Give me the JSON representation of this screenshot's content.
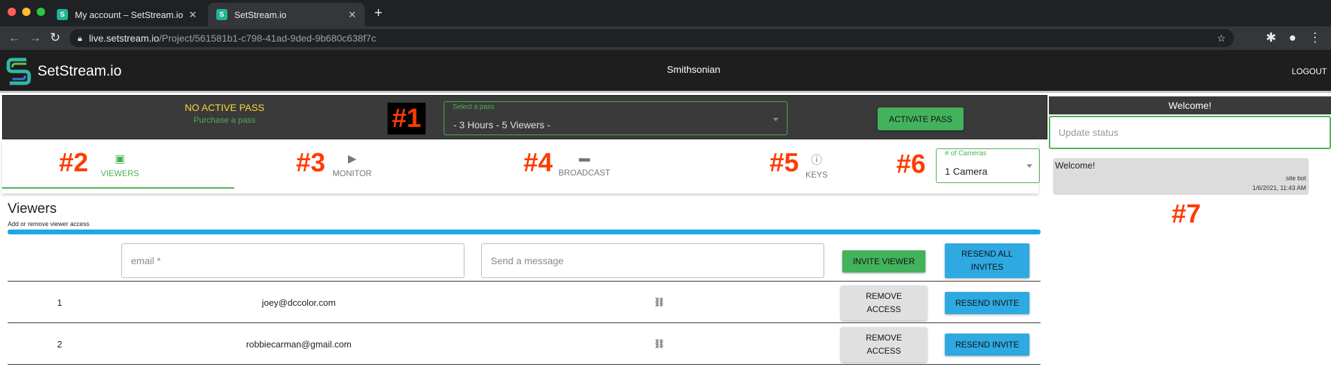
{
  "browser": {
    "tabs": [
      {
        "title": "My account – SetStream.io"
      },
      {
        "title": "SetStream.io"
      }
    ],
    "url_host": "live.setstream.io",
    "url_path": "/Project/561581b1-c798-41ad-9ded-9b680c638f7c"
  },
  "header": {
    "app_name": "SetStream.io",
    "organization": "Smithsonian",
    "logout": "LOGOUT"
  },
  "pass_bar": {
    "status": "NO ACTIVE PASS",
    "purchase_link": "Purchase a pass",
    "select_label": "Select a pass",
    "select_value": "- 3 Hours - 5 Viewers -",
    "activate_button": "ACTIVATE PASS"
  },
  "annotations": [
    "#1",
    "#2",
    "#3",
    "#4",
    "#5",
    "#6",
    "#7"
  ],
  "nav_tabs": [
    {
      "label": "VIEWERS",
      "icon": "contact-card-icon",
      "selected": true
    },
    {
      "label": "MONITOR",
      "icon": "tv-play-icon",
      "selected": false
    },
    {
      "label": "BROADCAST",
      "icon": "clapperboard-icon",
      "selected": false
    },
    {
      "label": "KEYS",
      "icon": "info-circle-icon",
      "selected": false
    }
  ],
  "cameras": {
    "label": "# of Cameras",
    "value": "1 Camera"
  },
  "sidebar": {
    "header": "Welcome!",
    "status_placeholder": "Update status",
    "messages": [
      {
        "text": "Welcome!",
        "author": "site bot",
        "time": "1/6/2021, 11:43 AM"
      }
    ]
  },
  "viewers": {
    "title": "Viewers",
    "subtitle": "Add or remove viewer access",
    "email_placeholder": "email *",
    "message_placeholder": "Send a message",
    "invite_button": "INVITE VIEWER",
    "resend_all_button": "RESEND ALL INVITES",
    "rows": [
      {
        "index": "1",
        "email": "joey@dccolor.com",
        "remove": "REMOVE ACCESS",
        "resend": "RESEND INVITE"
      },
      {
        "index": "2",
        "email": "robbiecarman@gmail.com",
        "remove": "REMOVE ACCESS",
        "resend": "RESEND INVITE"
      }
    ]
  },
  "colors": {
    "accent_green": "#4caf50",
    "accent_blue": "#1ea7e4",
    "annotation_red": "#ff3b00",
    "header_dark": "#1e1e1e"
  }
}
